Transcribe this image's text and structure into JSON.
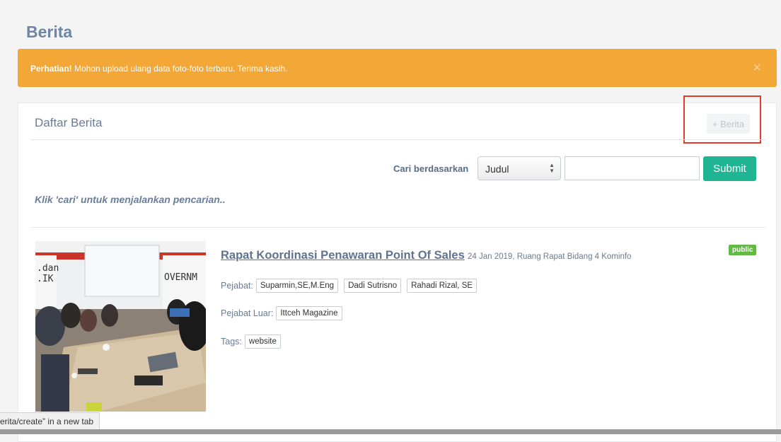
{
  "page": {
    "title": "Berita"
  },
  "alert": {
    "strong": "Perhatian!",
    "message": " Mohon upload ulang data foto-foto terbaru. Terima kasih.",
    "close_symbol": "×"
  },
  "panel": {
    "title": "Daftar Berita",
    "add_button": "+ Berita",
    "search": {
      "label": "Cari berdasarkan",
      "select_value": "Judul",
      "input_value": "",
      "submit": "Submit"
    },
    "hint": "Klik 'cari' untuk menjalankan pencarian.."
  },
  "news": [
    {
      "title": "Rapat Koordinasi Penawaran Point Of Sales",
      "meta": "24 Jan 2019, Ruang Rapat Bidang 4 Kominfo",
      "badge": "public",
      "pejabat_label": "Pejabat:",
      "pejabat": [
        "Suparmin,SE,M.Eng",
        "Dadi Sutrisno",
        "Rahadi Rizal, SE"
      ],
      "pejabat_luar_label": "Pejabat Luar:",
      "pejabat_luar": [
        "Ittceh Magazine"
      ],
      "tags_label": "Tags:",
      "tags": [
        "website"
      ]
    }
  ],
  "photo_text": {
    "line1": ".dan",
    "line2": ".IK",
    "line3": "OVERNM"
  },
  "statusbar": {
    "text": "erita/create” in a new tab"
  },
  "colors": {
    "alert": "#f3a737",
    "submit": "#1fb592",
    "badge": "#64b845",
    "highlight": "#e23b2e"
  }
}
